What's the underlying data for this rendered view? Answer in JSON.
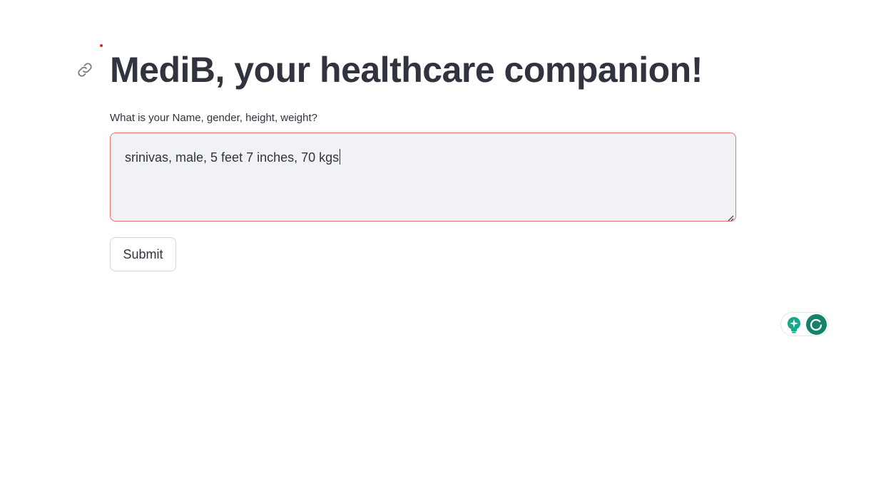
{
  "header": {
    "title": "MediB, your healthcare companion!",
    "anchor_icon": "link-icon"
  },
  "form": {
    "label": "What is your Name, gender, height, weight?",
    "input_value": "srinivas, male, 5 feet 7 inches, 70 kgs",
    "submit_label": "Submit"
  },
  "extension": {
    "assist_icon": "lightbulb-sparkle-icon",
    "grammarly_icon": "grammarly-icon"
  },
  "colors": {
    "text": "#31333f",
    "input_border": "#e8716c",
    "input_bg": "#f0f2f6",
    "accent_green": "#15836c",
    "status_dot": "#e0201b"
  }
}
